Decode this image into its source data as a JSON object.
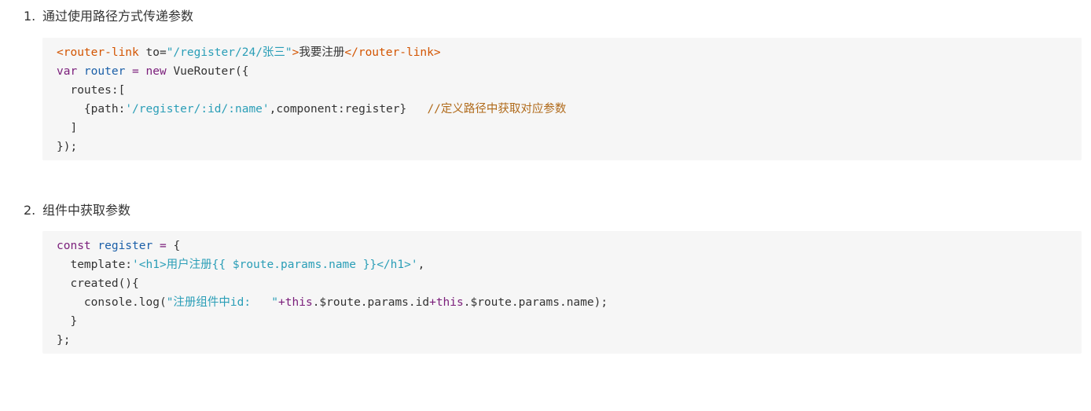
{
  "steps": [
    {
      "number": "1.",
      "title": "通过使用路径方式传递参数",
      "code_lines": [
        [
          [
            "tag",
            "<router-link "
          ],
          [
            "pln",
            "to="
          ],
          [
            "str",
            "\"/register/24/张三\""
          ],
          [
            "tag",
            ">"
          ],
          [
            "pln",
            "我要注册"
          ],
          [
            "tag",
            "</router-link>"
          ]
        ],
        [
          [
            "kw",
            "var "
          ],
          [
            "var",
            "router"
          ],
          [
            "pln",
            " "
          ],
          [
            "kw",
            "= new "
          ],
          [
            "pln",
            "VueRouter({"
          ]
        ],
        [
          [
            "pln",
            "  routes:["
          ]
        ],
        [
          [
            "pln",
            "    {path:"
          ],
          [
            "str",
            "'/register/:id/:name'"
          ],
          [
            "pln",
            ",component:register}   "
          ],
          [
            "cmt",
            "//定义路径中获取对应参数"
          ]
        ],
        [
          [
            "pln",
            "  ]"
          ]
        ],
        [
          [
            "pln",
            "});"
          ]
        ]
      ]
    },
    {
      "number": "2.",
      "title": "组件中获取参数",
      "code_lines": [
        [
          [
            "kw",
            "const "
          ],
          [
            "var",
            "register"
          ],
          [
            "pln",
            " "
          ],
          [
            "kw",
            "= "
          ],
          [
            "pln",
            "{"
          ]
        ],
        [
          [
            "pln",
            "  template:"
          ],
          [
            "str",
            "'<h1>用户注册{{ $route.params.name }}</h1>'"
          ],
          [
            "pln",
            ","
          ]
        ],
        [
          [
            "pln",
            "  created(){"
          ]
        ],
        [
          [
            "pln",
            "    console.log("
          ],
          [
            "str",
            "\"注册组件中id:   \""
          ],
          [
            "kw",
            "+this"
          ],
          [
            "pln",
            ".$route.params.id"
          ],
          [
            "kw",
            "+this"
          ],
          [
            "pln",
            ".$route.params.name);"
          ]
        ],
        [
          [
            "pln",
            "  }"
          ]
        ],
        [
          [
            "pln",
            "};"
          ]
        ]
      ]
    }
  ]
}
